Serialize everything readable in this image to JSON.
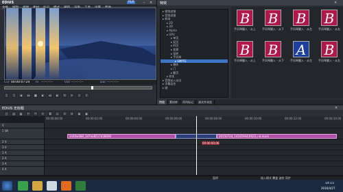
{
  "recorder": {
    "app_name": "EDIUS",
    "mode_label": "PLR",
    "menu": [
      "文件",
      "编辑",
      "视图",
      "素材",
      "标记",
      "模式",
      "捕获",
      "渲染",
      "工具",
      "设置",
      "帮助"
    ],
    "tc_cur_label": "Cur",
    "tc_cur": "00:00:07:24",
    "tc_in_label": "In",
    "tc_in": "--:--:--:--",
    "tc_out_label": "Out",
    "tc_out": "--:--:--:--",
    "tc_dur_label": "Dur",
    "tc_dur": "--:--:--:--"
  },
  "bin": {
    "title": "特效",
    "tree": [
      "视频滤镜",
      "音频滤镜",
      "转场",
      "2D",
      "3D",
      "Alpha",
      "GPU",
      "单页",
      "双页",
      "四页",
      "变换",
      "扭转",
      "手风琴",
      "SMPTE",
      "爆炸",
      "门",
      "翻页",
      "软化",
      "音频淡入淡出",
      "字幕混合",
      "键"
    ],
    "selected_index": 13,
    "thumbs": [
      {
        "label": "手风琴翻入 - 从上",
        "char": "B"
      },
      {
        "label": "手风琴翻入 - 从下",
        "char": "B"
      },
      {
        "label": "手风琴翻入 - 从左",
        "char": "B"
      },
      {
        "label": "手风琴翻入 - 从右",
        "char": "B"
      },
      {
        "label": "手风琴翻入 - 从上",
        "char": "B"
      },
      {
        "label": "手风琴翻入 - 从下",
        "char": "B"
      },
      {
        "label": "手风琴翻入 - 从左",
        "char": "A"
      },
      {
        "label": "手风琴翻入 - 从右",
        "char": "B"
      }
    ],
    "tabs": [
      "特效",
      "素材库",
      "序列标记",
      "源文件浏览"
    ]
  },
  "timeline": {
    "title": "EDIUS  无标题",
    "ruler": [
      "00:00:00:00",
      "00:00:02:00",
      "00:00:04:00",
      "00:00:06:00",
      "00:00:08:00",
      "00:00:10:00",
      "00:00:12:00",
      "00:00:14:00"
    ],
    "tracks": [
      "V",
      "1 VA",
      "2 V",
      "3 V",
      "1 A",
      "2 A",
      "3 A",
      "4 A"
    ],
    "clip_a": "1440w080_2d7ea8517d28690",
    "clip_c": "20150724_141059443fd23_nd.mark",
    "transition_tc": "00:00:00;06",
    "status": "暂停",
    "status_right": "插入模式    覆盖    波纹    同步"
  },
  "taskbar": {
    "time": "14:15",
    "date": "2016/4/27"
  },
  "colors": {
    "accent": "#3c74c8",
    "clip": "#b14fa7",
    "transition": "#2c3d78"
  }
}
